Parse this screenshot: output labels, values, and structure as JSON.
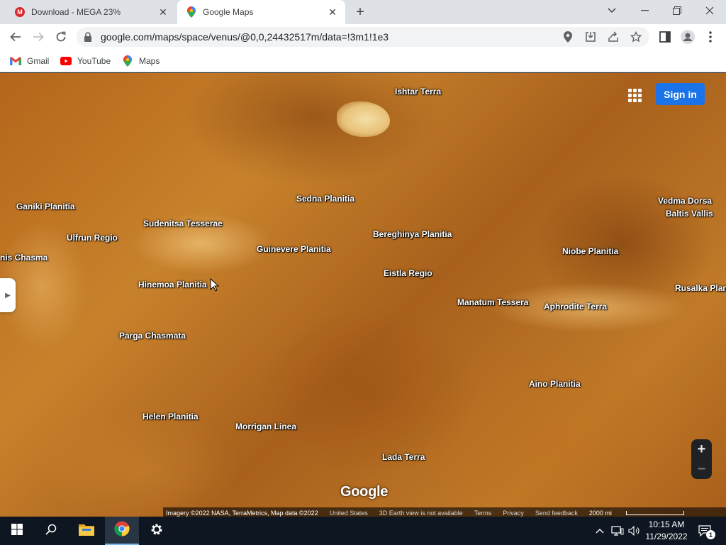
{
  "tabs": [
    {
      "title": "Download - MEGA 23%",
      "favicon": "mega-icon",
      "active": false
    },
    {
      "title": "Google Maps",
      "favicon": "google-maps-icon",
      "active": true
    }
  ],
  "toolbar": {
    "url": "google.com/maps/space/venus/@0,0,24432517m/data=!3m1!1e3"
  },
  "bookmarks": [
    {
      "label": "Gmail",
      "icon": "gmail-icon"
    },
    {
      "label": "YouTube",
      "icon": "youtube-icon"
    },
    {
      "label": "Maps",
      "icon": "maps-icon"
    }
  ],
  "map": {
    "sign_in": "Sign in",
    "logo": "Google",
    "labels": [
      "Ishtar Terra",
      "Ganiki Planitia",
      "Sudenitsa Tesserae",
      "Sedna Planitia",
      "Vedma Dorsa",
      "Baltis Vallis",
      "Ulfrun Regio",
      "Bereghinya Planitia",
      "Guinevere Planitia",
      "Niobe Planitia",
      "nis Chasma",
      "Eistla Regio",
      "Hinemoa Planitia",
      "Rusalka Plani",
      "Manatum Tessera",
      "Aphrodite Terra",
      "Parga Chasmata",
      "Aino Planitia",
      "Helen Planitia",
      "Morrigan Linea",
      "Lada Terra"
    ],
    "attribution": {
      "imagery": "Imagery ©2022 NASA, TerraMetrics, Map data ©2022",
      "country": "United States",
      "earth_view": "3D Earth view is not available",
      "terms": "Terms",
      "privacy": "Privacy",
      "feedback": "Send feedback",
      "scale": "2000 mi"
    }
  },
  "taskbar": {
    "time": "10:15 AM",
    "date": "11/29/2022",
    "notification_count": "1"
  }
}
